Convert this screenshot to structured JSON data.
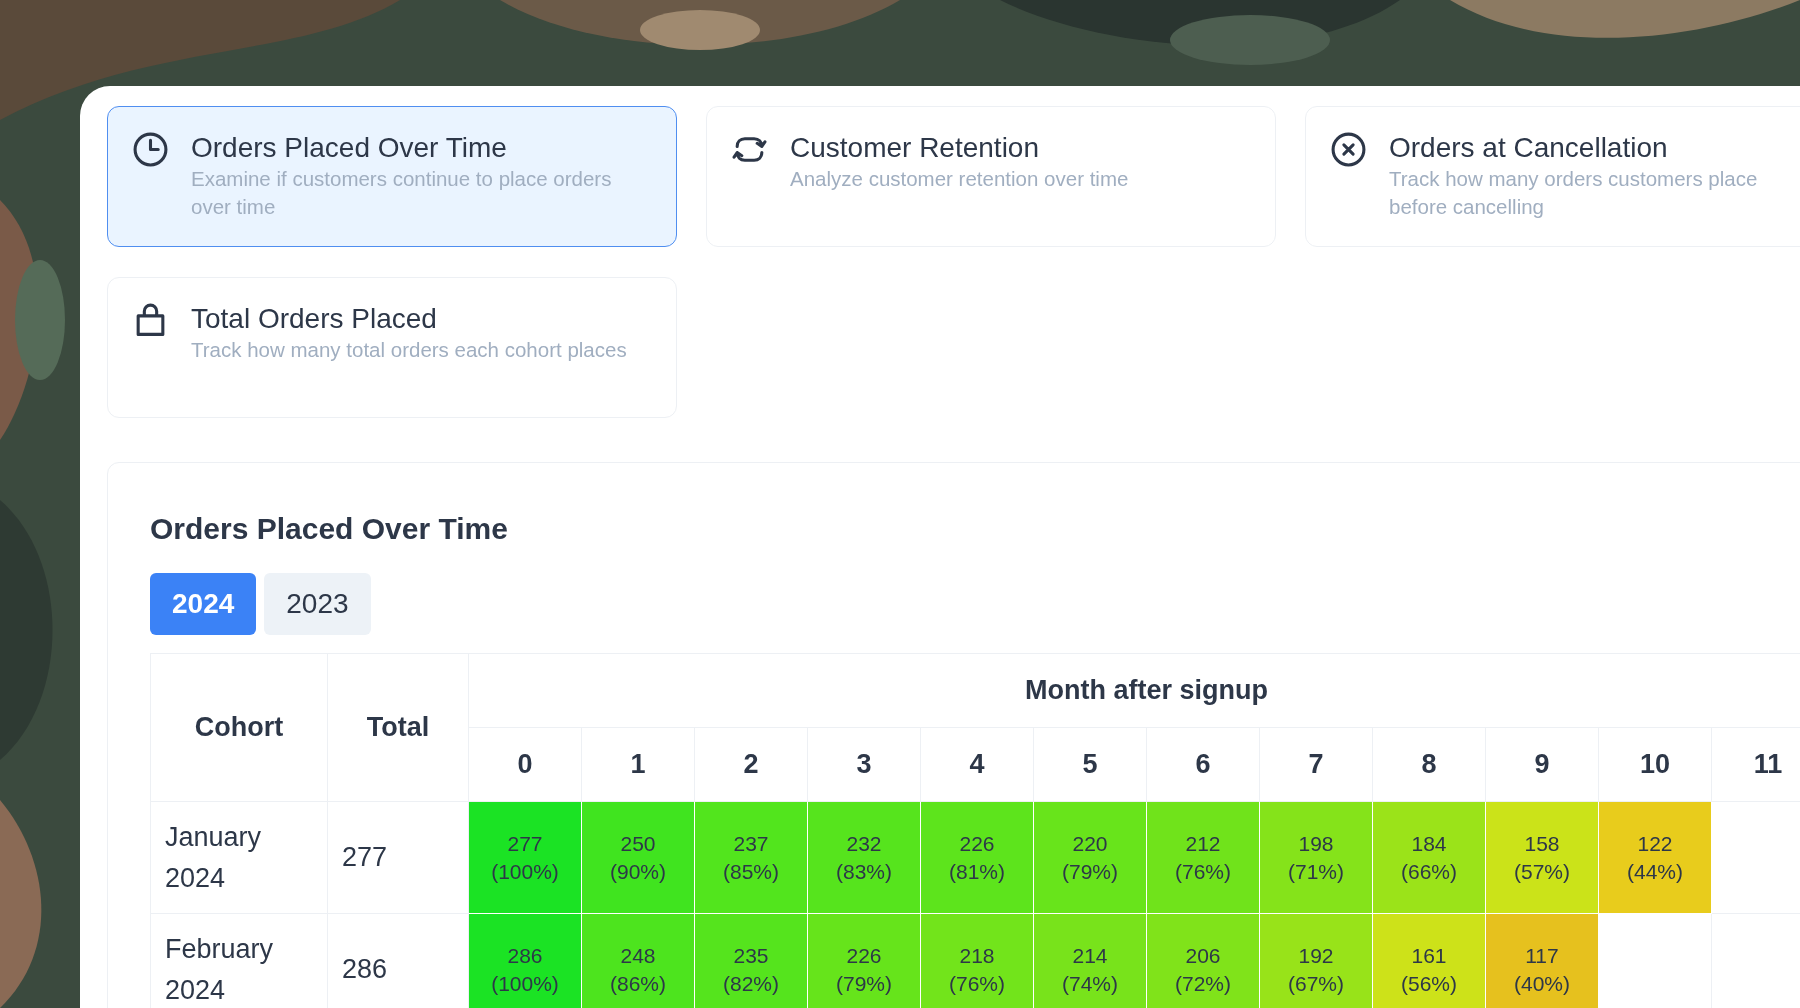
{
  "cards": [
    {
      "title": "Orders Placed Over Time",
      "description": "Examine if customers continue to place orders over time",
      "selected": true
    },
    {
      "title": "Customer Retention",
      "description": "Analyze customer retention over time",
      "selected": false
    },
    {
      "title": "Orders at Cancellation",
      "description": "Track how many orders customers place",
      "description_2": "before cancelling",
      "selected": false
    },
    {
      "title": "Total Orders Placed",
      "description": "Track how many total orders each cohort places",
      "selected": false
    }
  ],
  "section": {
    "title": "Orders Placed Over Time",
    "year_tabs": [
      {
        "label": "2024",
        "selected": true
      },
      {
        "label": "2023",
        "selected": false
      }
    ],
    "table": {
      "columns": [
        "Cohort",
        "Total"
      ],
      "group_header": "Month after signup",
      "months": [
        "0",
        "1",
        "2",
        "3",
        "4",
        "5",
        "6",
        "7",
        "8",
        "9",
        "10",
        "11"
      ],
      "rows": [
        {
          "cohort": "January 2024",
          "total": "277",
          "cells": [
            {
              "count": "277",
              "percent": "(100%)",
              "color": "#1be324"
            },
            {
              "count": "250",
              "percent": "(90%)",
              "color": "#40e41f"
            },
            {
              "count": "237",
              "percent": "(85%)",
              "color": "#52e51d"
            },
            {
              "count": "232",
              "percent": "(83%)",
              "color": "#56e41d"
            },
            {
              "count": "226",
              "percent": "(81%)",
              "color": "#5de41c"
            },
            {
              "count": "220",
              "percent": "(79%)",
              "color": "#68e41b"
            },
            {
              "count": "212",
              "percent": "(76%)",
              "color": "#70e31b"
            },
            {
              "count": "198",
              "percent": "(71%)",
              "color": "#85e31a"
            },
            {
              "count": "184",
              "percent": "(66%)",
              "color": "#9be319"
            },
            {
              "count": "158",
              "percent": "(57%)",
              "color": "#cbe319"
            },
            {
              "count": "122",
              "percent": "(44%)",
              "color": "#e8cc1c"
            }
          ]
        },
        {
          "cohort": "February 2024",
          "total": "286",
          "cells": [
            {
              "count": "286",
              "percent": "(100%)",
              "color": "#1be324"
            },
            {
              "count": "248",
              "percent": "(86%)",
              "color": "#4de41e"
            },
            {
              "count": "235",
              "percent": "(82%)",
              "color": "#55e41d"
            },
            {
              "count": "226",
              "percent": "(79%)",
              "color": "#66e41b"
            },
            {
              "count": "218",
              "percent": "(76%)",
              "color": "#72e41b"
            },
            {
              "count": "214",
              "percent": "(74%)",
              "color": "#78e31b"
            },
            {
              "count": "206",
              "percent": "(72%)",
              "color": "#80e31a"
            },
            {
              "count": "192",
              "percent": "(67%)",
              "color": "#98e319"
            },
            {
              "count": "161",
              "percent": "(56%)",
              "color": "#cde219"
            },
            {
              "count": "117",
              "percent": "(40%)",
              "color": "#e6c11e"
            }
          ]
        }
      ]
    }
  }
}
